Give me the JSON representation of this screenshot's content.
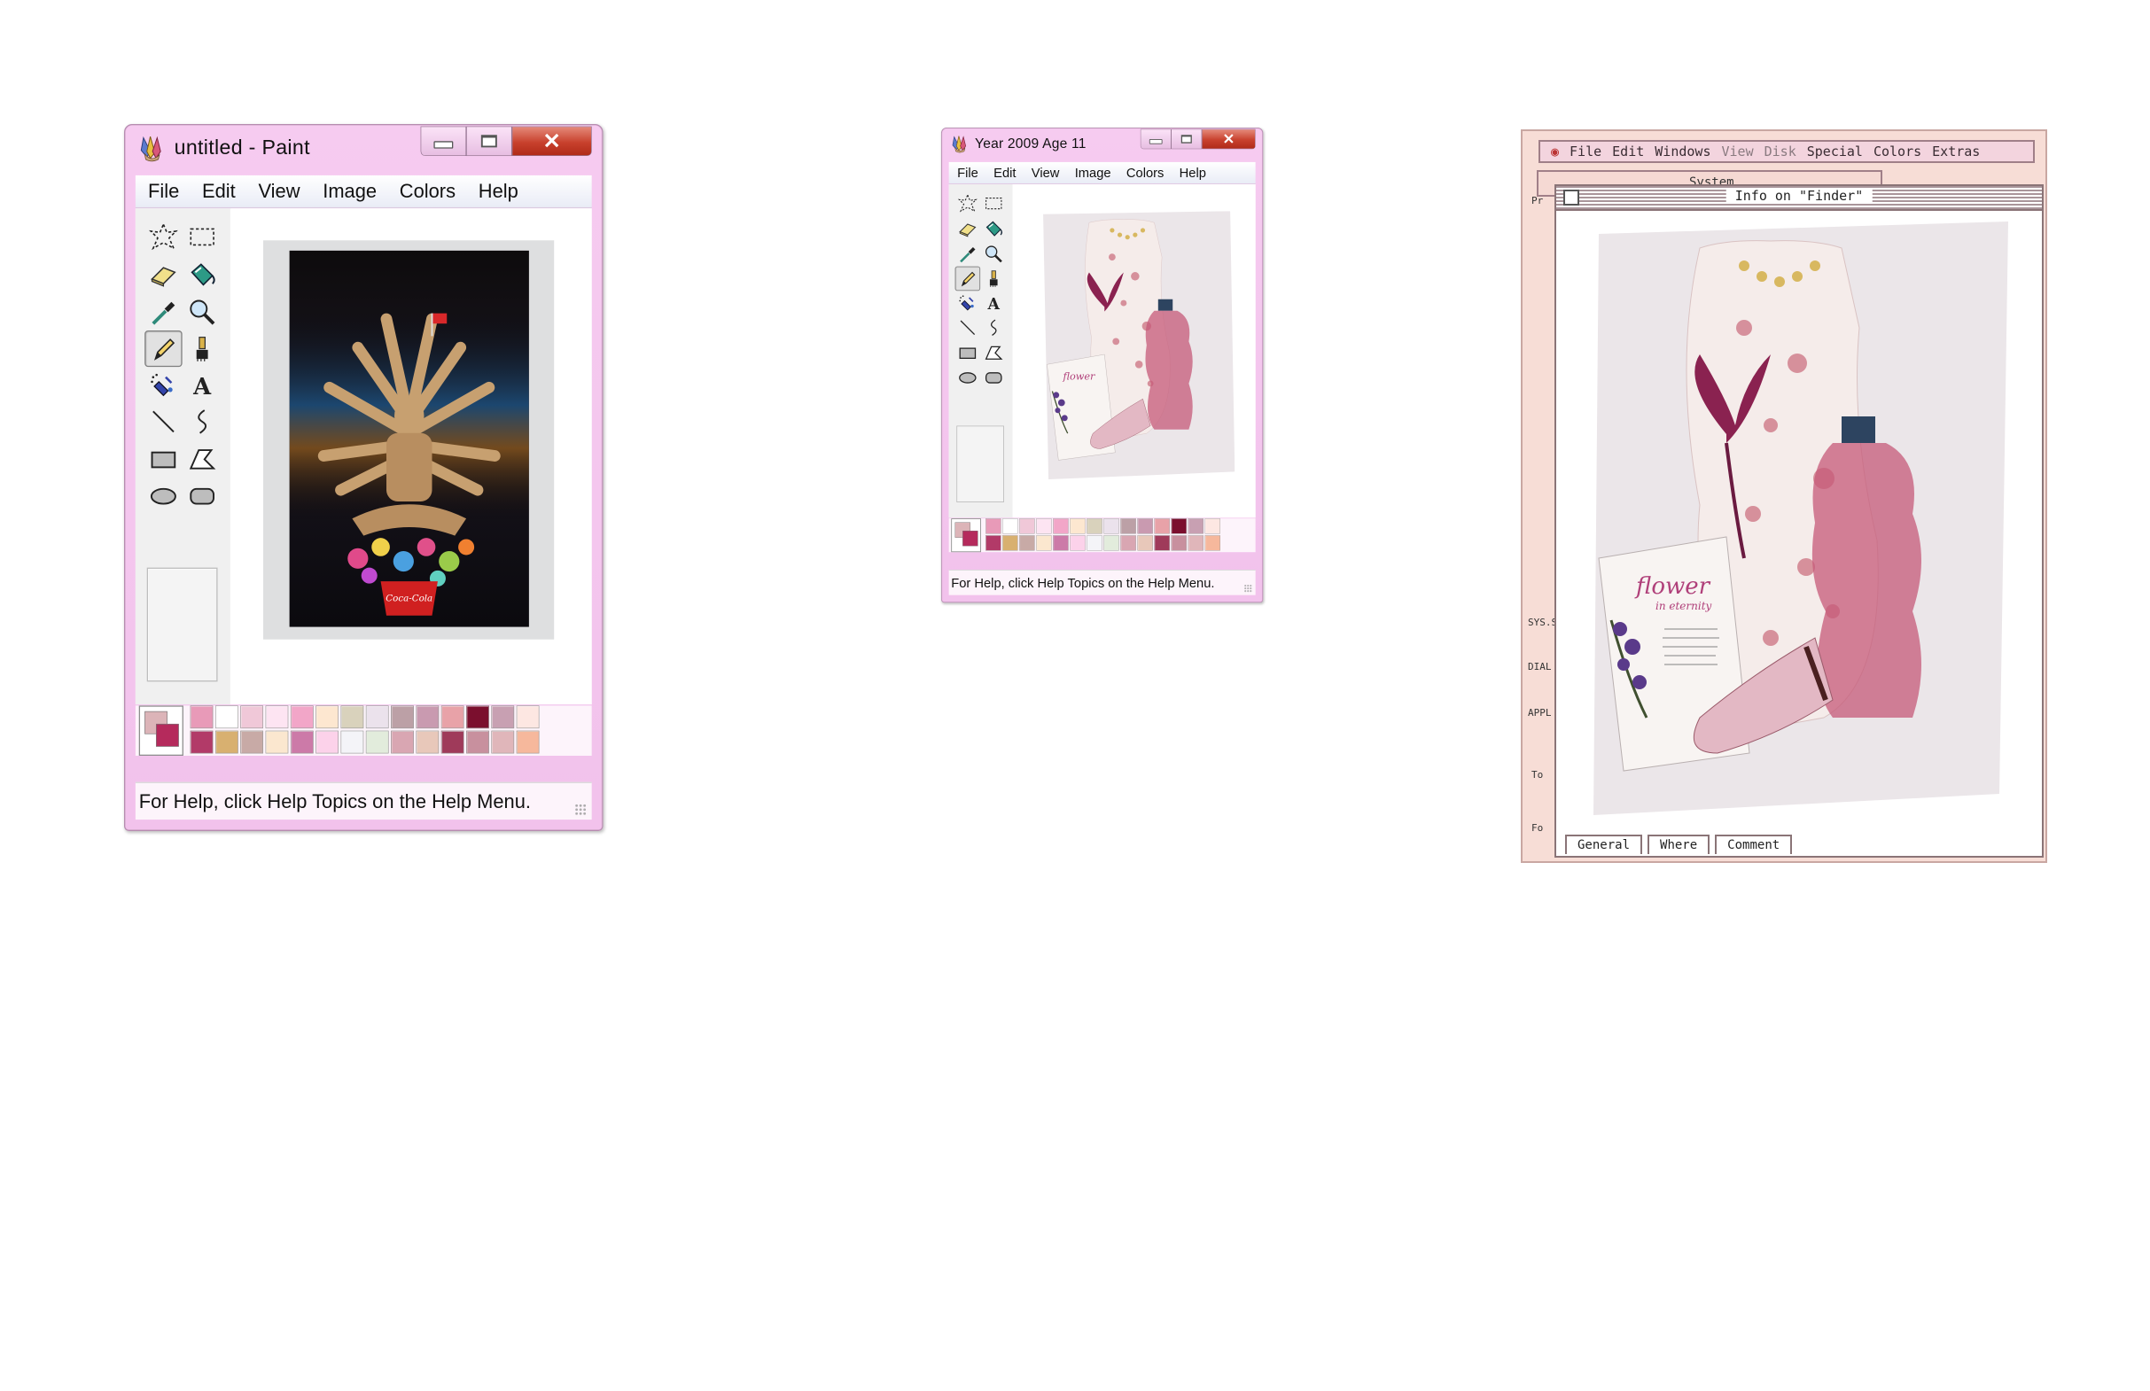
{
  "windows": [
    {
      "title": "untitled - Paint",
      "close_glyph": "✕",
      "menu": [
        "File",
        "Edit",
        "View",
        "Image",
        "Colors",
        "Help"
      ],
      "status": "For Help, click Help Topics on the Help Menu.",
      "selected_tool": "pencil",
      "foreground_color": "#dcb4b8",
      "background_color": "#b52a5c",
      "palette_top": [
        "#e89ab8",
        "#ffffff",
        "#f0c8d8",
        "#fde4f2",
        "#f2a6c8",
        "#fde7d0",
        "#d9d2bc",
        "#ebe2ec",
        "#bca0a6",
        "#c99ab0",
        "#e8a2a8",
        "#7b0f2e",
        "#c8a0b2",
        "#fde7e2"
      ],
      "palette_bottom": [
        "#b23a68",
        "#d8b070",
        "#c8aaa6",
        "#fbe7cf",
        "#cc7aa8",
        "#fcd2ea",
        "#f4f4f8",
        "#e2ecdc",
        "#d9a6b2",
        "#e8c8ba",
        "#9f3a5a",
        "#c8909e",
        "#e0b6ba",
        "#f6b89c"
      ]
    },
    {
      "title": "Year 2009 Age 11",
      "close_glyph": "✕",
      "menu": [
        "File",
        "Edit",
        "View",
        "Image",
        "Colors",
        "Help"
      ],
      "status": "For Help, click Help Topics on the Help Menu.",
      "selected_tool": "pencil",
      "foreground_color": "#dcb4b8",
      "background_color": "#b52a5c",
      "palette_top": [
        "#e89ab8",
        "#ffffff",
        "#f0c8d8",
        "#fde4f2",
        "#f2a6c8",
        "#fde7d0",
        "#d9d2bc",
        "#ebe2ec",
        "#bca0a6",
        "#c99ab0",
        "#e8a2a8",
        "#7b0f2e",
        "#c8a0b2",
        "#fde7e2"
      ],
      "palette_bottom": [
        "#b23a68",
        "#d8b070",
        "#c8aaa6",
        "#fbe7cf",
        "#cc7aa8",
        "#fcd2ea",
        "#f4f4f8",
        "#e2ecdc",
        "#d9a6b2",
        "#e8c8ba",
        "#9f3a5a",
        "#c8909e",
        "#e0b6ba",
        "#f6b89c"
      ]
    }
  ],
  "tools": [
    "free-select",
    "rect-select",
    "eraser",
    "fill",
    "picker",
    "magnifier",
    "pencil",
    "brush",
    "airbrush",
    "text",
    "line",
    "curve",
    "rectangle",
    "polygon",
    "ellipse",
    "rounded-rectangle"
  ],
  "collage_text": {
    "card_title": "flower",
    "card_subtitle": "in eternity"
  },
  "photo_text": {
    "can_label": "Coca-Cola"
  },
  "mac_window": {
    "menu": [
      "File",
      "Edit",
      "Windows",
      "View",
      "Disk",
      "Special",
      "Colors",
      "Extras"
    ],
    "background_title": "System",
    "info_title": "Info on \"Finder\"",
    "tabs": [
      "General",
      "Where",
      "Comment"
    ],
    "side_labels": [
      "Pr",
      "SYS.S",
      "DIAL",
      "APPL",
      "To",
      "Fo"
    ]
  }
}
